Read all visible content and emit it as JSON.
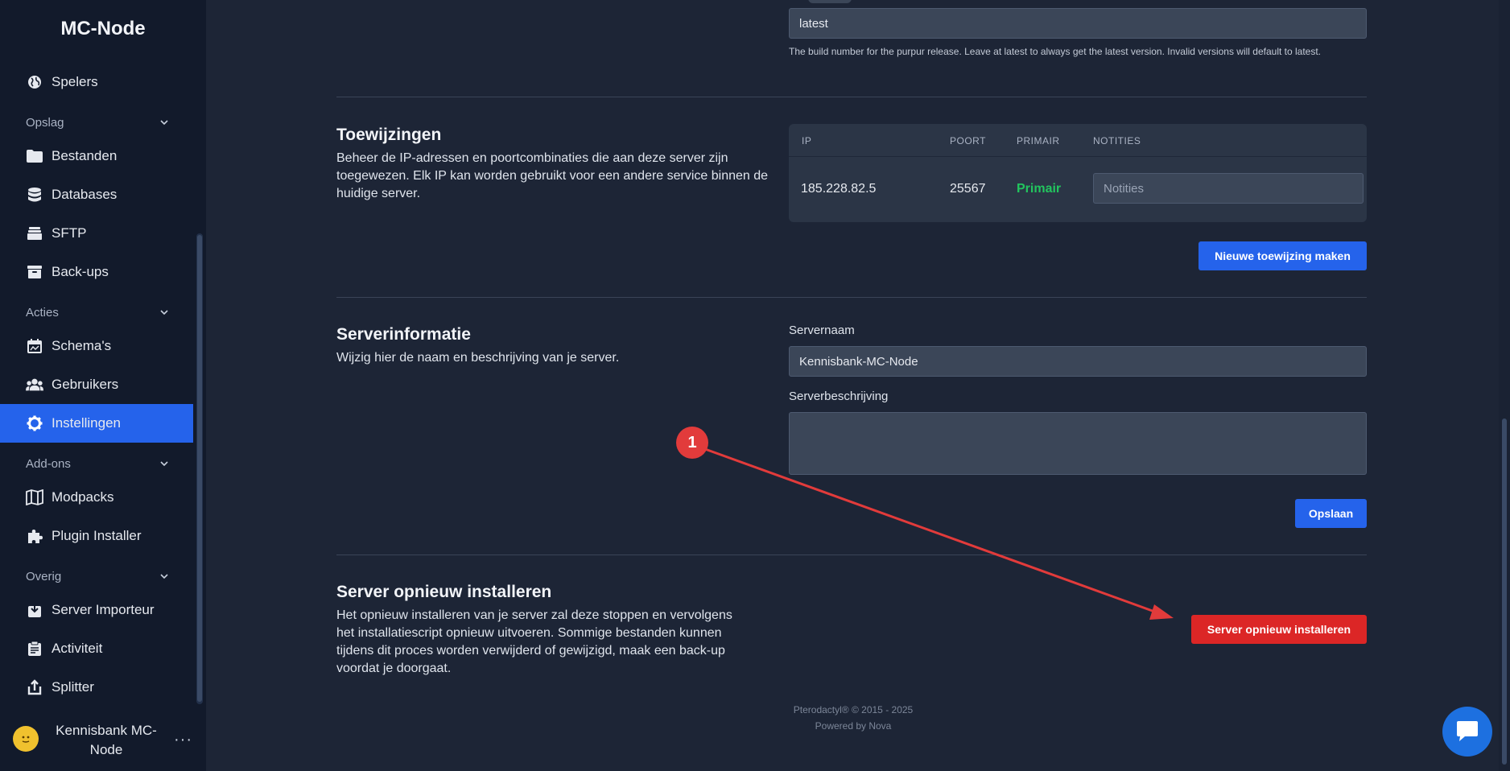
{
  "sidebar": {
    "brand": "MC-Node",
    "items": {
      "spelers": "Spelers",
      "bestanden": "Bestanden",
      "databases": "Databases",
      "sftp": "SFTP",
      "backups": "Back-ups",
      "schemas": "Schema's",
      "gebruikers": "Gebruikers",
      "instellingen": "Instellingen",
      "modpacks": "Modpacks",
      "plugin_installer": "Plugin Installer",
      "server_importeur": "Server Importeur",
      "activiteit": "Activiteit",
      "splitter": "Splitter"
    },
    "sections": {
      "opslag": "Opslag",
      "acties": "Acties",
      "addons": "Add-ons",
      "overig": "Overig"
    },
    "user": {
      "name": "Kennisbank MC-Node",
      "menu": "···"
    }
  },
  "build": {
    "value": "latest",
    "help": "The build number for the purpur release. Leave at latest to always get the latest version. Invalid versions will default to latest."
  },
  "allocations": {
    "title": "Toewijzingen",
    "description": "Beheer de IP-adressen en poortcombinaties die aan deze server zijn toegewezen. Elk IP kan worden gebruikt voor een andere service binnen de huidige server.",
    "columns": {
      "ip": "IP",
      "port": "POORT",
      "primary": "PRIMAIR",
      "notes": "NOTITIES"
    },
    "row": {
      "ip": "185.228.82.5",
      "port": "25567",
      "primary": "Primair",
      "notes_placeholder": "Notities"
    },
    "new_button": "Nieuwe toewijzing maken"
  },
  "server_info": {
    "title": "Serverinformatie",
    "description": "Wijzig hier de naam en beschrijving van je server.",
    "name_label": "Servernaam",
    "name_value": "Kennisbank-MC-Node",
    "desc_label": "Serverbeschrijving",
    "save_button": "Opslaan"
  },
  "reinstall": {
    "title": "Server opnieuw installeren",
    "description": "Het opnieuw installeren van je server zal deze stoppen en vervolgens het installatiescript opnieuw uitvoeren. Sommige bestanden kunnen tijdens dit proces worden verwijderd of gewijzigd, maak een back-up voordat je doorgaat.",
    "button": "Server opnieuw installeren"
  },
  "footer": {
    "line1": "Pterodactyl® © 2015 - 2025",
    "line2": "Powered by Nova"
  },
  "annotation": {
    "number": "1"
  },
  "colors": {
    "accent": "#2563eb",
    "danger": "#dc2626",
    "success": "#22c55e",
    "sidebar_bg": "#121a2b",
    "main_bg": "#1d2536"
  },
  "icons": [
    "globe-icon",
    "folder-icon",
    "database-icon",
    "sftp-icon",
    "archive-icon",
    "calendar-icon",
    "users-icon",
    "gear-icon",
    "map-icon",
    "puzzle-icon",
    "import-icon",
    "clipboard-icon",
    "upload-icon",
    "chevron-down-icon",
    "chat-icon"
  ]
}
